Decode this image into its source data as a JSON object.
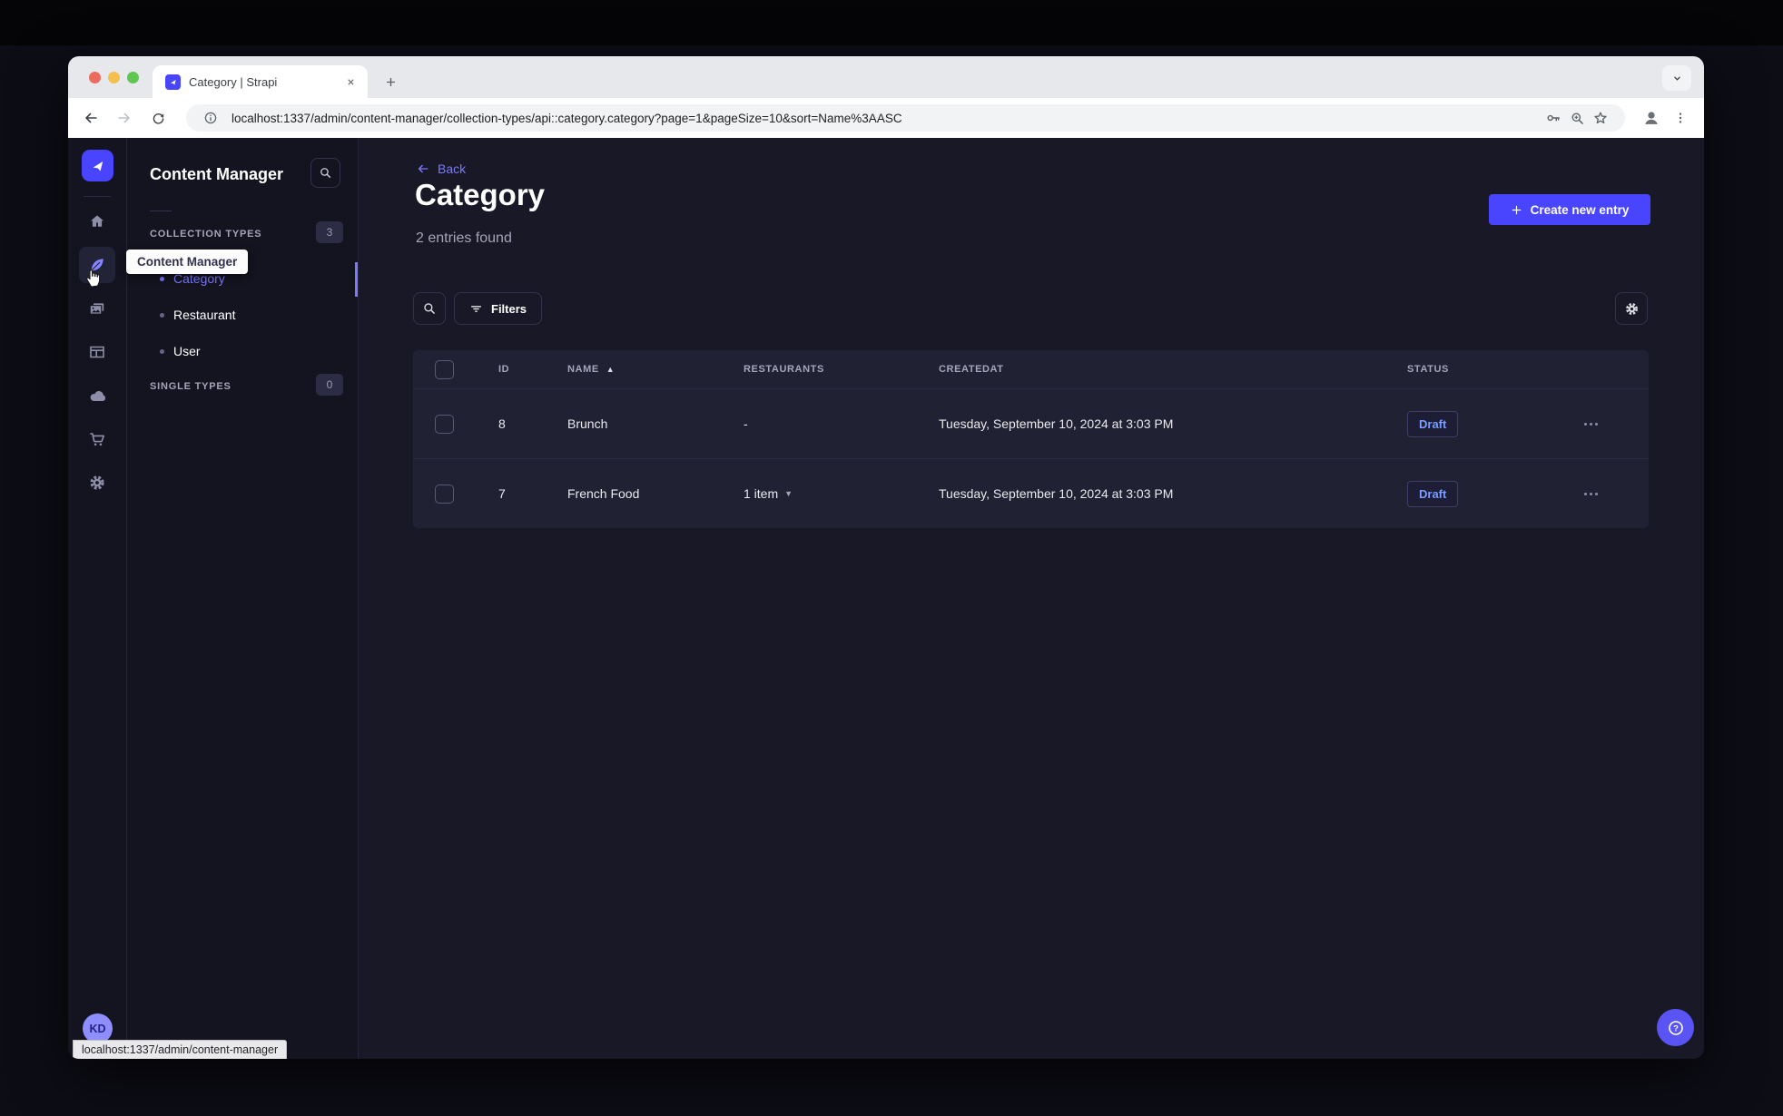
{
  "browser": {
    "tab_title": "Category | Strapi",
    "url": "localhost:1337/admin/content-manager/collection-types/api::category.category?page=1&pageSize=10&sort=Name%3AASC",
    "status_link": "localhost:1337/admin/content-manager"
  },
  "rail": {
    "avatar_initials": "KD"
  },
  "subnav": {
    "title": "Content Manager",
    "sections": [
      {
        "label": "COLLECTION TYPES",
        "count": "3",
        "items": [
          {
            "label": "Category"
          },
          {
            "label": "Restaurant"
          },
          {
            "label": "User"
          }
        ]
      },
      {
        "label": "SINGLE TYPES",
        "count": "0",
        "items": []
      }
    ]
  },
  "tooltip": {
    "text": "Content Manager"
  },
  "header": {
    "back_label": "Back",
    "title": "Category",
    "subtitle": "2 entries found",
    "create_button": "Create new entry"
  },
  "actions": {
    "filters_label": "Filters"
  },
  "table": {
    "headers": [
      "ID",
      "NAME",
      "RESTAURANTS",
      "CREATEDAT",
      "STATUS"
    ],
    "rows": [
      {
        "id": "8",
        "name": "Brunch",
        "restaurants": "-",
        "createdat": "Tuesday, September 10, 2024 at 3:03 PM",
        "status": "Draft"
      },
      {
        "id": "7",
        "name": "French Food",
        "restaurants": "1 item",
        "createdat": "Tuesday, September 10, 2024 at 3:03 PM",
        "status": "Draft"
      }
    ]
  },
  "colors": {
    "accent": "#4945ff",
    "link": "#7b79ff",
    "draft_text": "#7b9dff",
    "card_bg": "#212134",
    "app_bg": "#181826"
  }
}
